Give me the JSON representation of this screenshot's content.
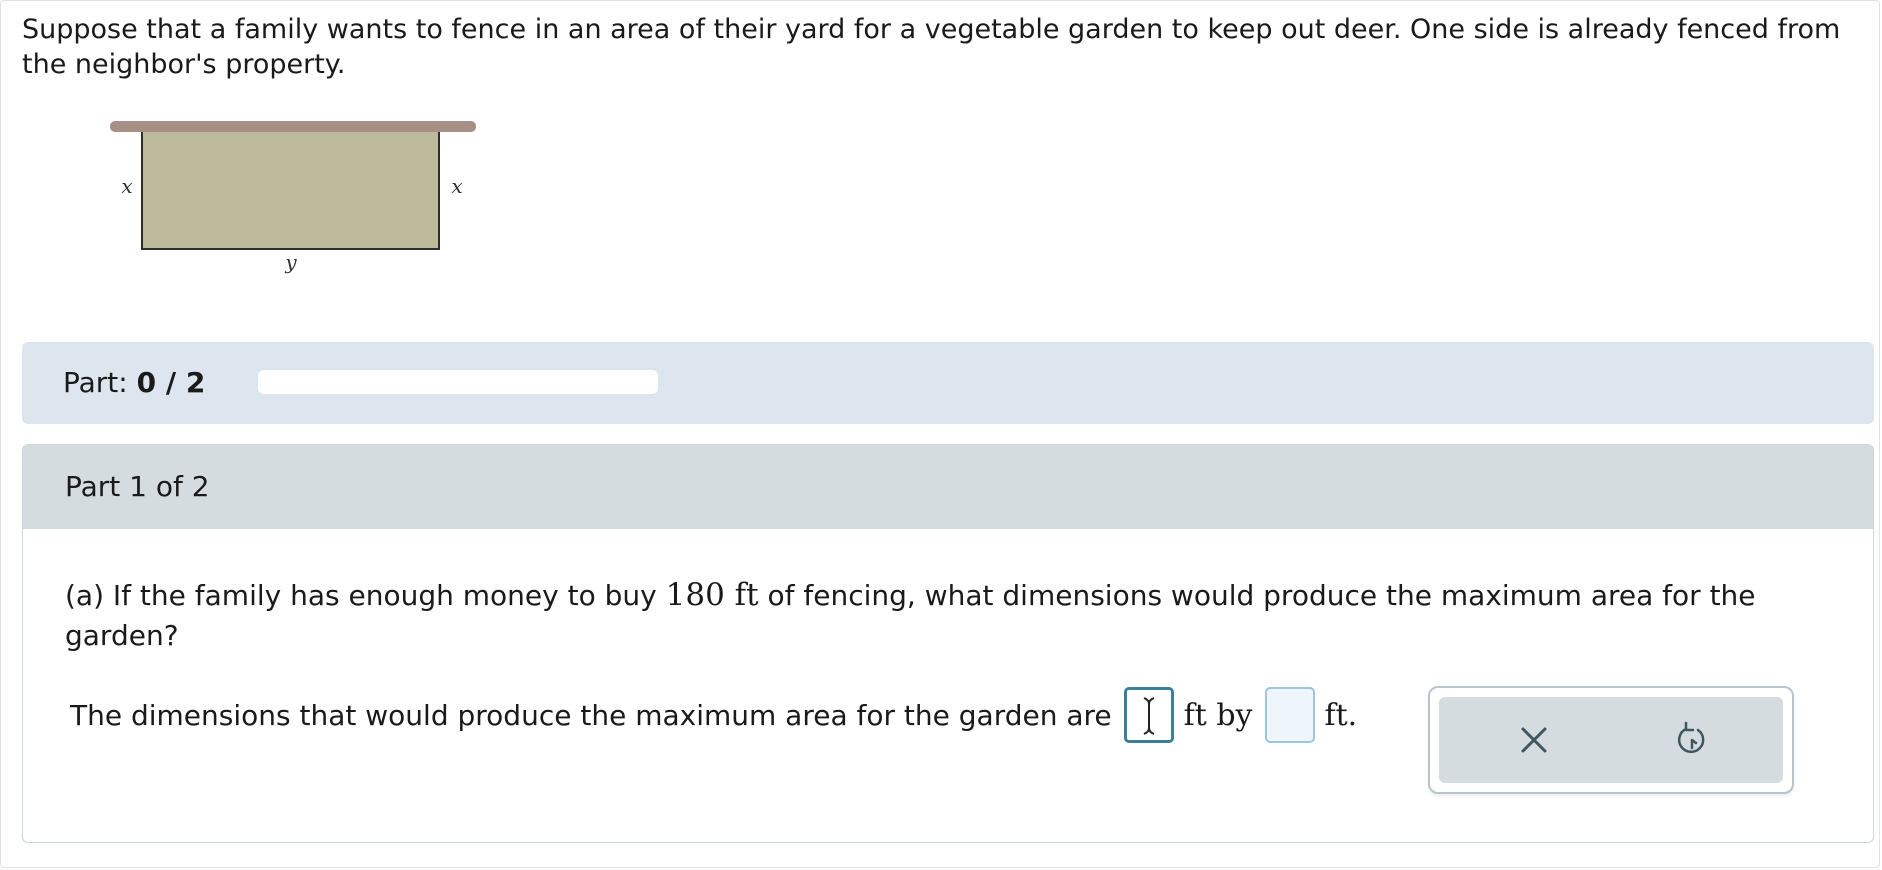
{
  "problem": {
    "text": "Suppose that a family wants to fence in an area of their yard for a vegetable garden to keep out deer. One side is already fenced from the neighbor's property.",
    "figure": {
      "left_label": "x",
      "right_label": "x",
      "bottom_label": "y",
      "fill_color": "#bdb99b",
      "fence_color": "#a68f84"
    }
  },
  "part_bar": {
    "label": "Part:",
    "value": "0 / 2",
    "progress_fraction": 0
  },
  "section": {
    "title": "Part 1 of 2",
    "question_prefix": "(a) If the family has enough money to buy",
    "question_amount": "180 ft",
    "question_suffix": "of fencing, what dimensions would produce the maximum area for the garden?",
    "answer_prefix": "The dimensions that would produce the maximum area for the garden are",
    "answer_mid": "ft by",
    "answer_end": "ft.",
    "answer_1_value": "",
    "answer_2_value": ""
  },
  "tools": {
    "clear_icon": "close-icon",
    "undo_icon": "undo-icon"
  },
  "colors": {
    "part_bar_bg": "#dde6ee",
    "section_header_bg": "#d4dcdf",
    "active_border": "#3a7f9c",
    "input_border": "#9cc6dc"
  }
}
